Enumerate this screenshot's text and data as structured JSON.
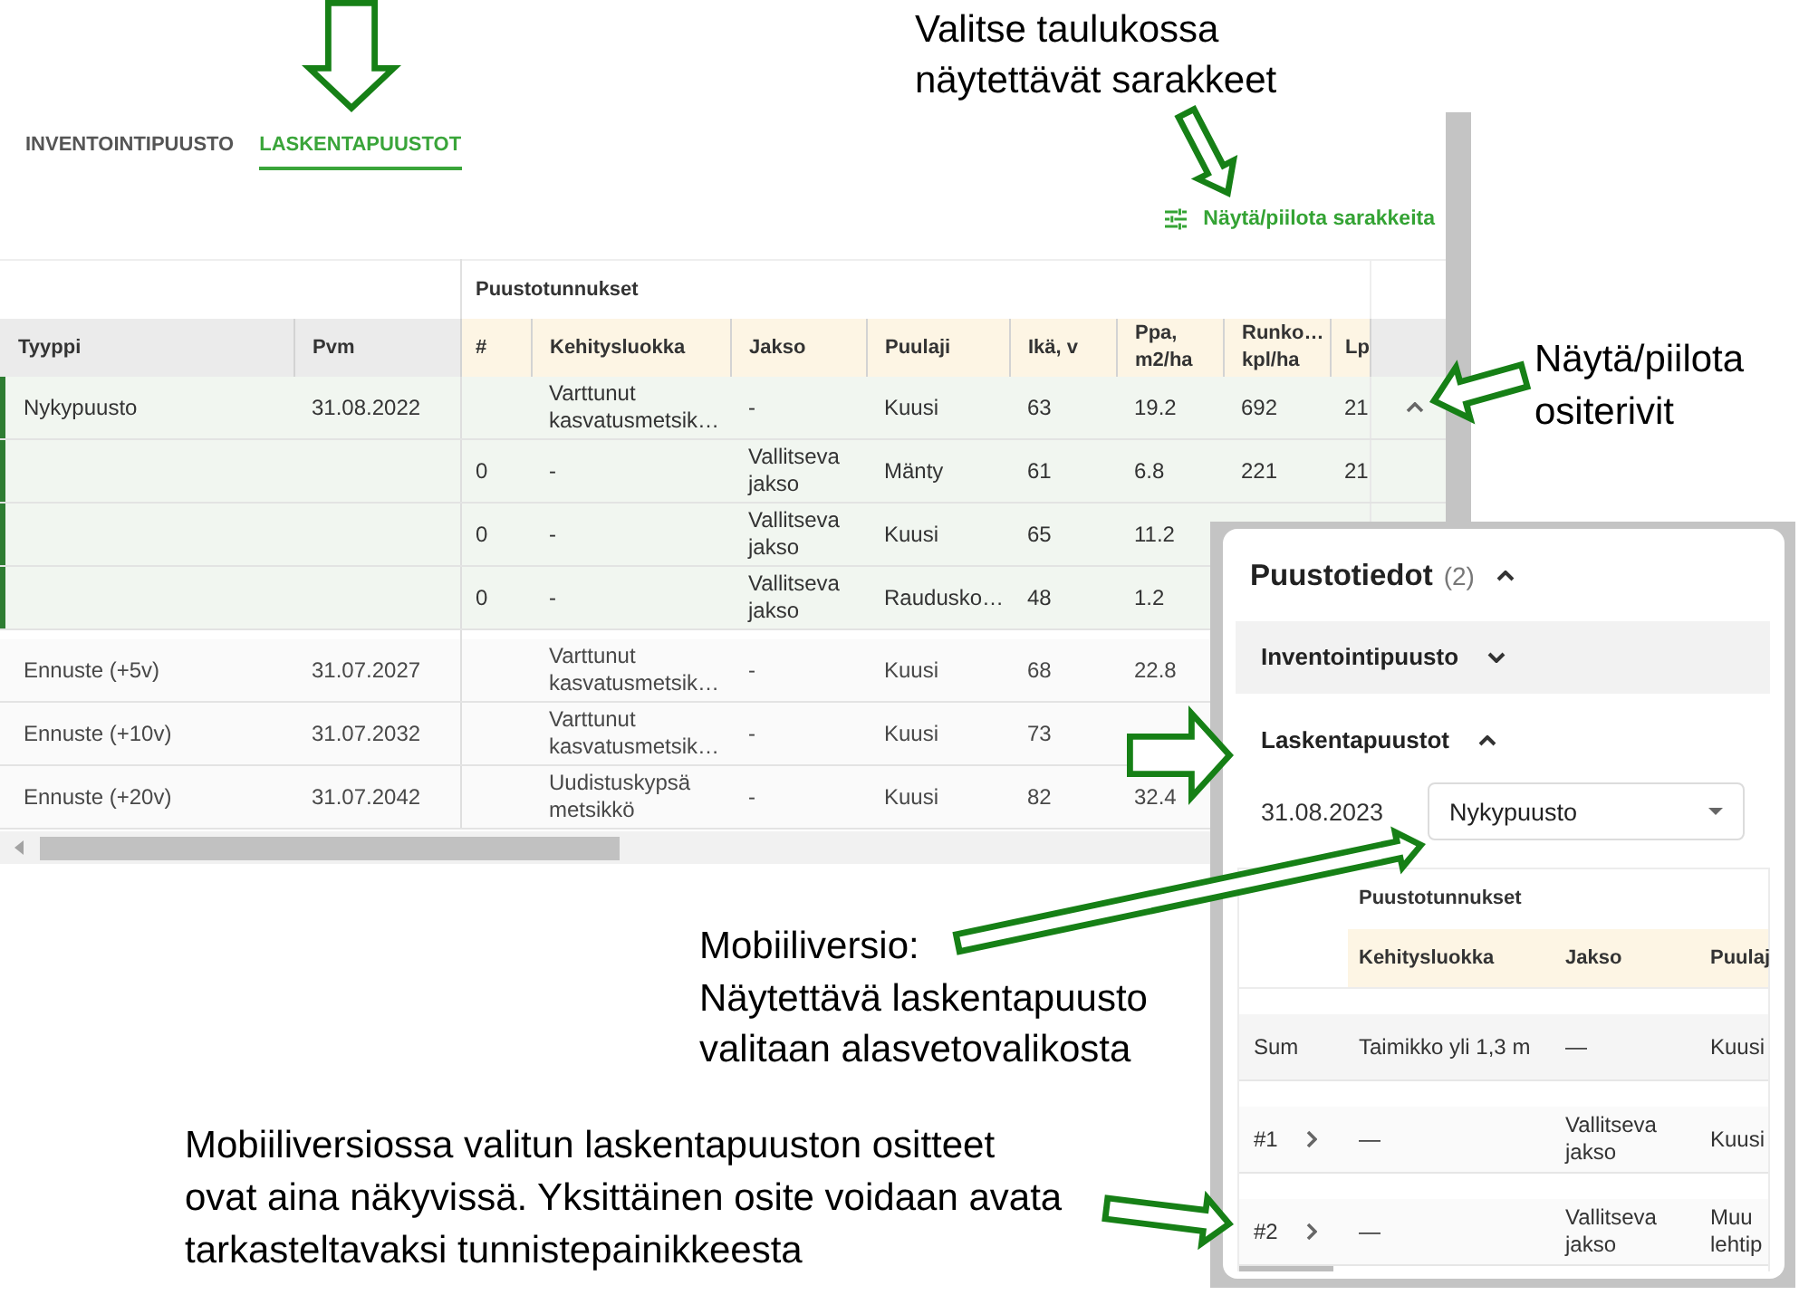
{
  "desktop": {
    "tabs": [
      {
        "label": "INVENTOINTIPUUSTO",
        "selected": false
      },
      {
        "label": "LASKENTAPUUSTOT",
        "selected": true
      }
    ],
    "column_toggle": {
      "label": "Näytä/piilota sarakkeita"
    },
    "table": {
      "group_header": "Puustotunnukset",
      "columns": [
        "Tyyppi",
        "Pvm",
        "#",
        "Kehitysluokka",
        "Jakso",
        "Puulaji",
        "Ikä, v",
        "Ppa, m2/ha",
        "Runko… kpl/ha",
        "Lp"
      ],
      "rows": [
        {
          "type": "Nykypuusto",
          "date": "31.08.2022",
          "development_class": "Varttunut kasvatusmetsik…",
          "period": "-",
          "species": "Kuusi",
          "age": "63",
          "basal_area": "19.2",
          "stem_count": "692",
          "lp": "21",
          "expanded": true,
          "children": [
            {
              "number": "0",
              "development_class": "-",
              "period": "Vallitseva jakso",
              "species": "Mänty",
              "age": "61",
              "basal_area": "6.8",
              "stem_count": "221",
              "lp": "21"
            },
            {
              "number": "0",
              "development_class": "-",
              "period": "Vallitseva jakso",
              "species": "Kuusi",
              "age": "65",
              "basal_area": "11.2"
            },
            {
              "number": "0",
              "development_class": "-",
              "period": "Vallitseva jakso",
              "species": "Raudusko…",
              "age": "48",
              "basal_area": "1.2"
            }
          ]
        },
        {
          "type": "Ennuste (+5v)",
          "date": "31.07.2027",
          "development_class": "Varttunut kasvatusmetsik…",
          "period": "-",
          "species": "Kuusi",
          "age": "68",
          "basal_area": "22.8",
          "expanded": false
        },
        {
          "type": "Ennuste (+10v)",
          "date": "31.07.2032",
          "development_class": "Varttunut kasvatusmetsik…",
          "period": "-",
          "species": "Kuusi",
          "age": "73",
          "expanded": false
        },
        {
          "type": "Ennuste (+20v)",
          "date": "31.07.2042",
          "development_class": "Uudistuskypsä metsikkö",
          "period": "-",
          "species": "Kuusi",
          "age": "82",
          "basal_area": "32.4",
          "expanded": false
        }
      ]
    }
  },
  "mobile": {
    "title": "Puustotiedot",
    "count": "(2)",
    "expanded": true,
    "sections": [
      {
        "title": "Inventointipuusto",
        "expanded": false
      },
      {
        "title": "Laskentapuustot",
        "expanded": true,
        "date": "31.08.2023",
        "dropdown": {
          "value": "Nykypuusto"
        },
        "table": {
          "group_header": "Puustotunnukset",
          "columns": [
            "Kehitysluokka",
            "Jakso",
            "Puulaj"
          ],
          "rows": [
            {
              "kind": "sum",
              "label": "Sum",
              "cells": [
                "Taimikko yli 1,3 m",
                "—",
                "Kuusi"
              ]
            },
            {
              "kind": "stratum",
              "label": "#1",
              "cells": [
                "—",
                "Vallitseva jakso",
                "Kuusi"
              ]
            },
            {
              "kind": "stratum",
              "label": "#2",
              "cells": [
                "—",
                "Vallitseva jakso",
                "Muu lehtip"
              ]
            }
          ]
        }
      }
    ]
  },
  "annotations": [
    {
      "text": "Valitse taulukossa näytettävät sarakkeet"
    },
    {
      "text": "Näytä/piilota ositerivit"
    },
    {
      "lead": "Mobiiliversio:",
      "text": "Näytettävä laskentapuusto valitaan alasvetovalikosta"
    },
    {
      "text": "Mobiiliversiossa valitun laskentapuuston ositteet ovat aina näkyvissä. Yksittäinen osite voidaan avata tarkasteltavaksi tunnistepainikkeesta"
    }
  ]
}
